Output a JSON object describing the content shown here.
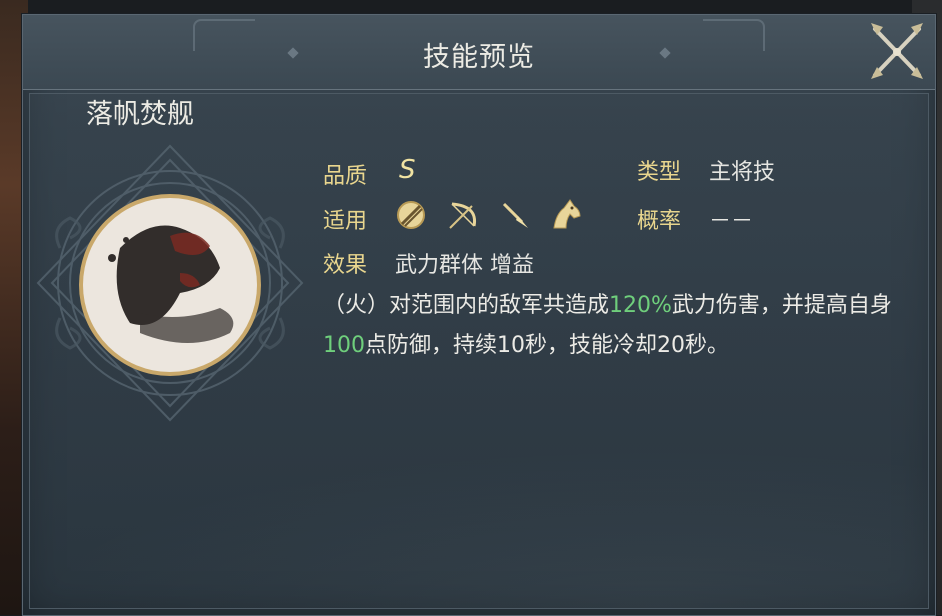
{
  "dialog": {
    "title": "技能预览",
    "close_icon": "crossed-swords-close-icon"
  },
  "skill": {
    "name": "落帆焚舰",
    "quality_label": "品质",
    "quality_value": "S",
    "type_label": "类型",
    "type_value": "主将技",
    "applicable_label": "适用",
    "applicable_icons": [
      "shield-icon",
      "bow-icon",
      "spear-icon",
      "horse-icon"
    ],
    "rate_label": "概率",
    "rate_value": "－－",
    "effect_label": "效果",
    "effect_value": "武力群体 增益",
    "description": {
      "part1": "（火）对范围内的敌军共造成",
      "highlight1": "120%",
      "part2": "武力伤害，并提高自身",
      "highlight2": "100",
      "part3": "点防御，持续10秒，技能冷却20秒。"
    }
  },
  "colors": {
    "label": "#e9d68e",
    "highlight": "#6fcf7c",
    "text": "#ecebe6"
  }
}
